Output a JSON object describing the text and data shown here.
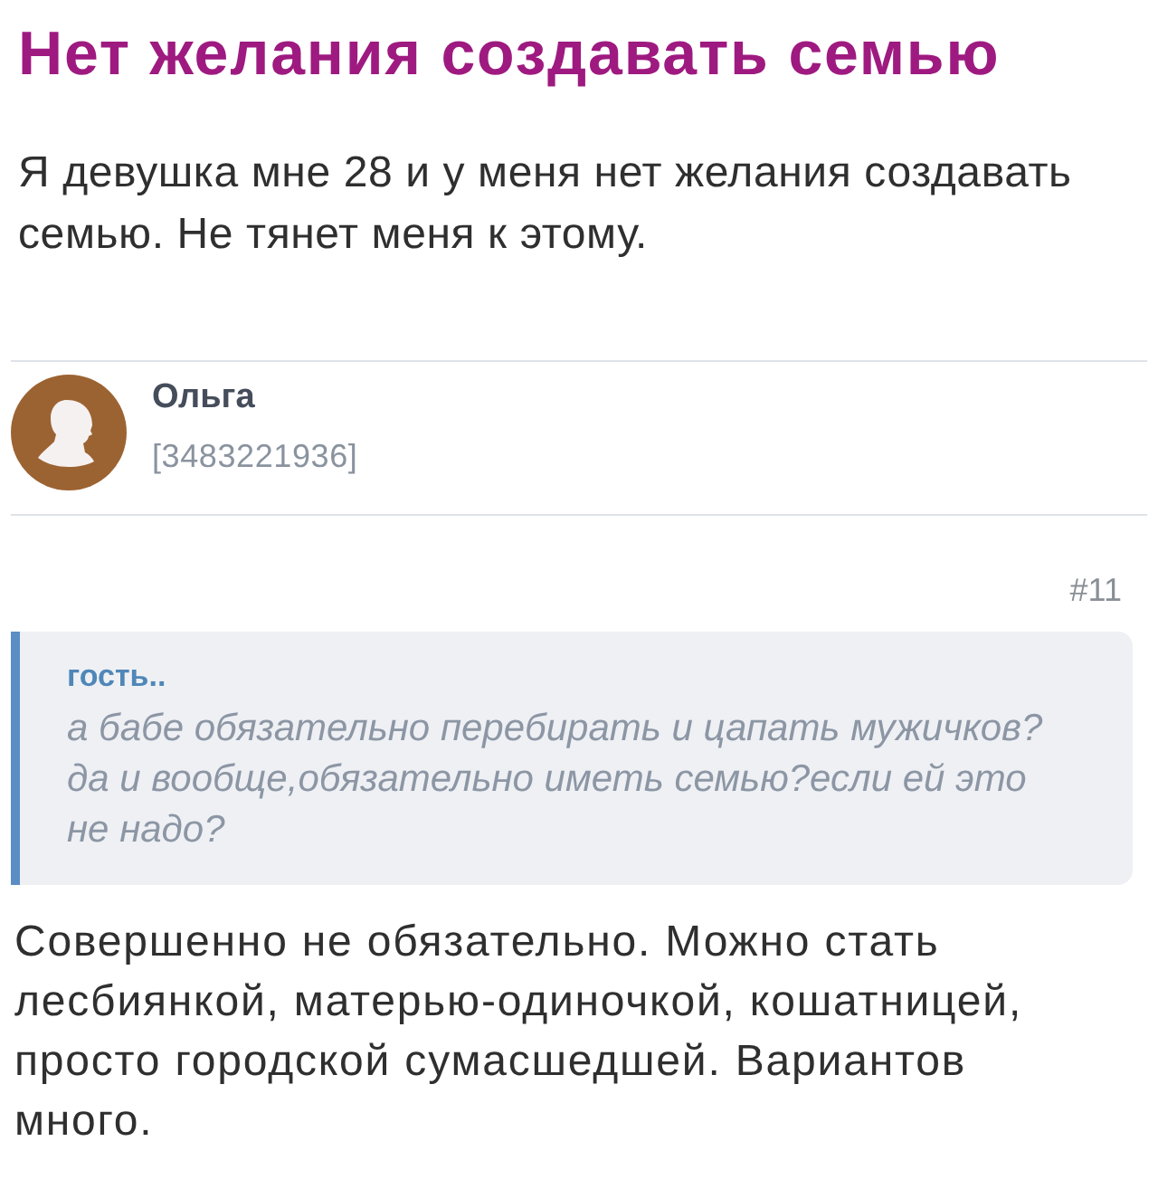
{
  "post": {
    "title": "Нет желания создавать семью",
    "body": "Я девушка мне 28 и у меня нет желания создавать\nсемью. Не тянет меня к этому."
  },
  "author": {
    "name": "Ольга",
    "id": "[3483221936]"
  },
  "reply": {
    "number": "#11",
    "quote": {
      "author": "гость..",
      "text": "а бабе обязательно перебирать и цапать мужичков?\nда и вообще,обязательно иметь семью?если ей это\nне надо?"
    },
    "text": "Совершенно не обязательно. Можно стать\nлесбиянкой, матерью-одиночкой, кошатницей,\nпросто городской сумасшедшей. Вариантов\nмного."
  }
}
